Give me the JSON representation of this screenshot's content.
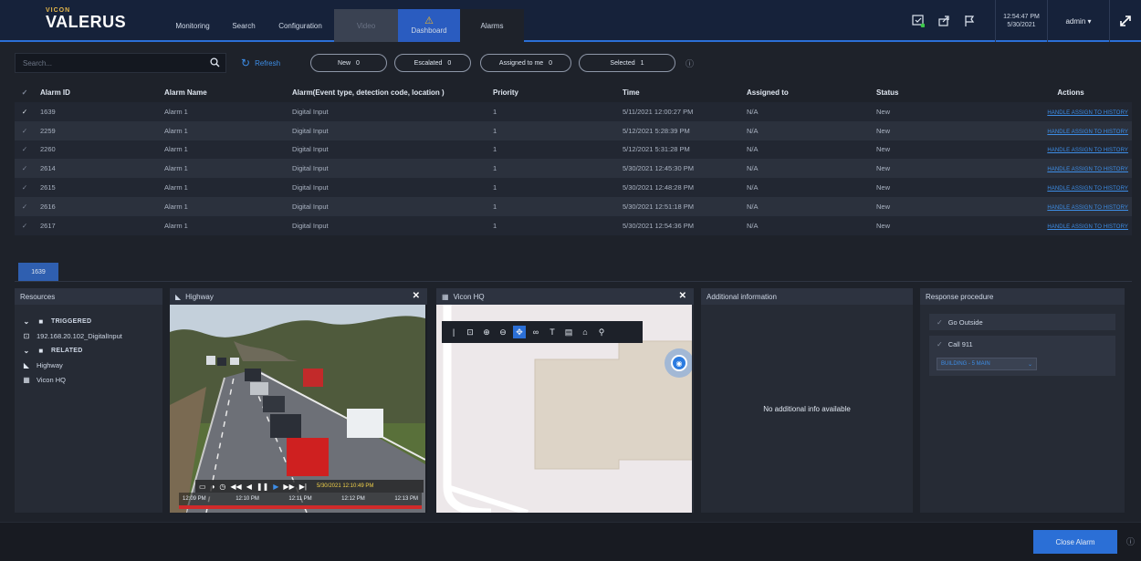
{
  "brand": {
    "top": "VICON",
    "name": "VALERUS"
  },
  "nav": {
    "items": [
      "Monitoring",
      "Search",
      "Configuration",
      "Video",
      "Dashboard",
      "Alarms"
    ],
    "active": "Alarms"
  },
  "header": {
    "time": "12:54:47 PM",
    "date": "5/30/2021",
    "user": "admin ▾"
  },
  "filters": {
    "search_placeholder": "Search...",
    "refresh_label": "Refresh",
    "new": "New",
    "new_count": "0",
    "escalated": "Escalated",
    "escalated_count": "0",
    "assigned": "Assigned to me",
    "assigned_count": "0",
    "selected": "Selected",
    "selected_count": "1"
  },
  "table": {
    "headers": [
      "Alarm ID",
      "Alarm Name",
      "Alarm(Event type, detection code, location )",
      "Priority",
      "Time",
      "Assigned to",
      "Status",
      "Actions"
    ],
    "rows": [
      {
        "id": "1639",
        "name": "Alarm 1",
        "type": "Digital Input",
        "priority": "1",
        "time": "5/11/2021 12:00:27 PM",
        "assigned": "N/A",
        "status": "New",
        "checked": true
      },
      {
        "id": "2259",
        "name": "Alarm 1",
        "type": "Digital Input",
        "priority": "1",
        "time": "5/12/2021 5:28:39 PM",
        "assigned": "N/A",
        "status": "New",
        "checked": false
      },
      {
        "id": "2260",
        "name": "Alarm 1",
        "type": "Digital Input",
        "priority": "1",
        "time": "5/12/2021 5:31:28 PM",
        "assigned": "N/A",
        "status": "New",
        "checked": false
      },
      {
        "id": "2614",
        "name": "Alarm 1",
        "type": "Digital Input",
        "priority": "1",
        "time": "5/30/2021 12:45:30 PM",
        "assigned": "N/A",
        "status": "New",
        "checked": false
      },
      {
        "id": "2615",
        "name": "Alarm 1",
        "type": "Digital Input",
        "priority": "1",
        "time": "5/30/2021 12:48:28 PM",
        "assigned": "N/A",
        "status": "New",
        "checked": false
      },
      {
        "id": "2616",
        "name": "Alarm 1",
        "type": "Digital Input",
        "priority": "1",
        "time": "5/30/2021 12:51:18 PM",
        "assigned": "N/A",
        "status": "New",
        "checked": false
      },
      {
        "id": "2617",
        "name": "Alarm 1",
        "type": "Digital Input",
        "priority": "1",
        "time": "5/30/2021 12:54:36 PM",
        "assigned": "N/A",
        "status": "New",
        "checked": false
      }
    ],
    "actions": "HANDLE ASSIGN TO HISTORY"
  },
  "alarm_tab": "1639",
  "resources": {
    "title": "Resources",
    "triggered": "TRIGGERED",
    "trigger_item": "192.168.20.102_DigitalInput",
    "related": "RELATED",
    "related_items": [
      "Highway",
      "Vicon HQ"
    ]
  },
  "camera": {
    "title": "Highway",
    "timestamp": "5/30/2021 12:10:49 PM",
    "timeline": [
      "12:09 PM",
      "12:10 PM",
      "12:11 PM",
      "12:12 PM",
      "12:13 PM"
    ]
  },
  "map": {
    "title": "Vicon HQ"
  },
  "additional": {
    "title": "Additional information",
    "empty": "No additional info available"
  },
  "response": {
    "title": "Response procedure",
    "steps": [
      "Go Outside",
      "Call 911"
    ],
    "select_value": "BUILDING - 5 MAIN"
  },
  "footer": {
    "close_label": "Close Alarm"
  },
  "colors": {
    "accent": "#2b6fd6",
    "link": "#3d8de6",
    "warning": "#f2b824",
    "recording": "#d02a2a"
  }
}
